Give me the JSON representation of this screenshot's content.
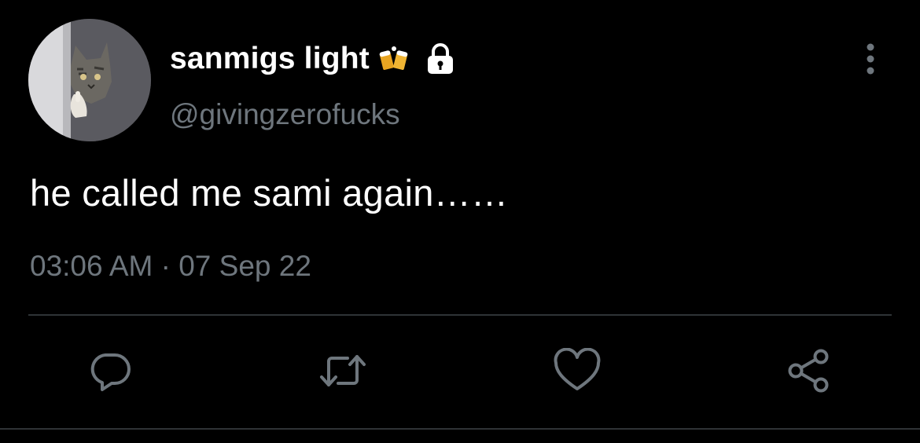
{
  "user": {
    "display_name": "sanmigs light",
    "name_emoji": "beer-mugs-icon",
    "lock": "lock-icon",
    "handle": "@givingzerofucks",
    "avatar": "avatar-cat-icon"
  },
  "tweet": {
    "text": "he called me sami again……",
    "time": "03:06 AM",
    "separator": "·",
    "date": "07 Sep 22"
  },
  "actions": {
    "more": "more-vertical-icon",
    "reply": "reply-icon",
    "retweet": "retweet-icon",
    "like": "heart-icon",
    "share": "share-icon"
  },
  "colors": {
    "background": "#000000",
    "primary_text": "#ffffff",
    "secondary_text": "#6e767d",
    "divider": "#2f3336"
  }
}
